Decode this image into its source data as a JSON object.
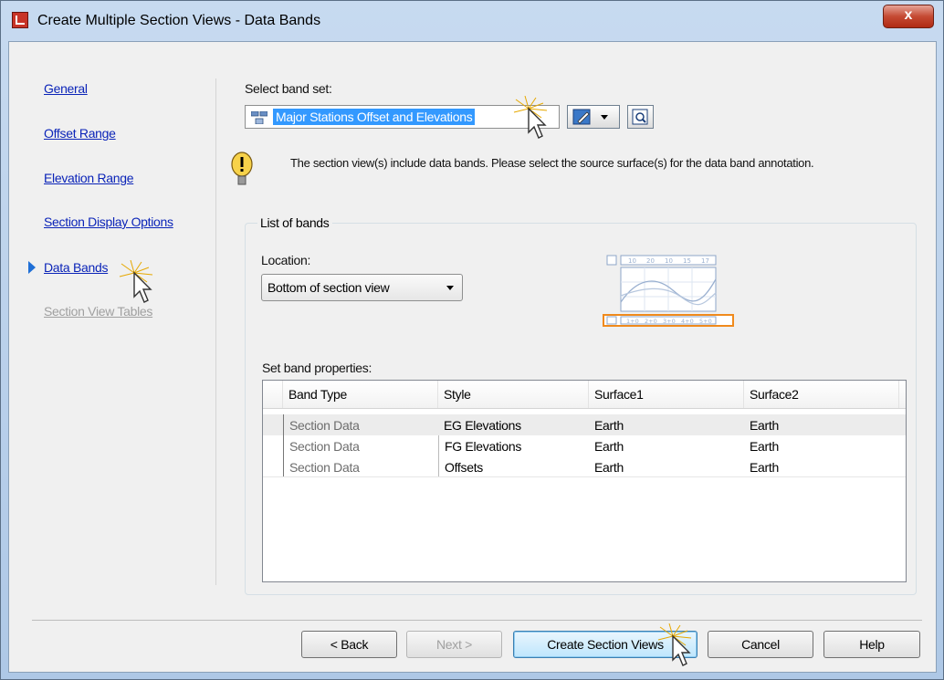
{
  "window": {
    "title": "Create Multiple Section Views - Data Bands",
    "close_glyph": "x"
  },
  "nav": {
    "items": [
      {
        "label": "General",
        "state": "link"
      },
      {
        "label": "Offset Range",
        "state": "link"
      },
      {
        "label": "Elevation Range",
        "state": "link"
      },
      {
        "label": "Section Display Options",
        "state": "link"
      },
      {
        "label": "Data Bands",
        "state": "current"
      },
      {
        "label": "Section View Tables",
        "state": "disabled"
      }
    ]
  },
  "band_set": {
    "label": "Select band set:",
    "value": "Major Stations Offset and Elevations"
  },
  "info": {
    "message": "The section view(s) include data bands. Please select the source surface(s) for the data band annotation."
  },
  "bands_group": {
    "title": "List of bands",
    "location_label": "Location:",
    "location_value": "Bottom of section view",
    "preview_top_ticks": [
      "10",
      "20",
      "10",
      "15",
      "17"
    ],
    "preview_bottom_ticks": [
      "1+0",
      "2+0",
      "3+0",
      "4+0",
      "5+0"
    ]
  },
  "properties": {
    "label": "Set band properties:",
    "columns": [
      "Band Type",
      "Style",
      "Surface1",
      "Surface2"
    ],
    "rows": [
      [
        "Section Data",
        "EG Elevations",
        "Earth",
        "Earth"
      ],
      [
        "Section Data",
        "FG Elevations",
        "Earth",
        "Earth"
      ],
      [
        "Section Data",
        "Offsets",
        "Earth",
        "Earth"
      ]
    ]
  },
  "buttons": {
    "back": "< Back",
    "next": "Next >",
    "create": "Create Section Views",
    "cancel": "Cancel",
    "help": "Help"
  },
  "colors": {
    "link": "#0b24b8",
    "selection": "#3399ff",
    "preview_highlight": "#f08a1c"
  }
}
